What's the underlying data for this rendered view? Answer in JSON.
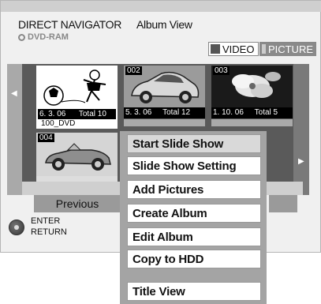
{
  "header": {
    "title": "DIRECT NAVIGATOR",
    "view": "Album View",
    "disc": "DVD-RAM"
  },
  "tabs": [
    {
      "label": "VIDEO"
    },
    {
      "label": "PICTURE"
    }
  ],
  "albums": [
    {
      "number": "",
      "date": "6. 3. 06",
      "total": "Total 10",
      "name": "100_DVD",
      "picture": "soccer-player-drawing"
    },
    {
      "number": "002",
      "date": "5. 3. 06",
      "total": "Total 12",
      "picture": "car-photo"
    },
    {
      "number": "003",
      "date": "1. 10. 06",
      "total": "Total 5",
      "picture": "flower-photo"
    },
    {
      "number": "004",
      "picture": "convertible-car-drawing"
    }
  ],
  "nav": {
    "previous": "Previous"
  },
  "remote": {
    "enter": "ENTER",
    "return": "RETURN"
  },
  "menu": {
    "items": [
      {
        "label": "Start Slide Show",
        "active": true
      },
      {
        "label": "Slide Show Setting"
      },
      {
        "label": "Add Pictures"
      },
      {
        "label": "Create Album"
      },
      {
        "label": "Edit Album"
      },
      {
        "label": "Copy to HDD"
      },
      {
        "label": "Title View"
      }
    ]
  }
}
